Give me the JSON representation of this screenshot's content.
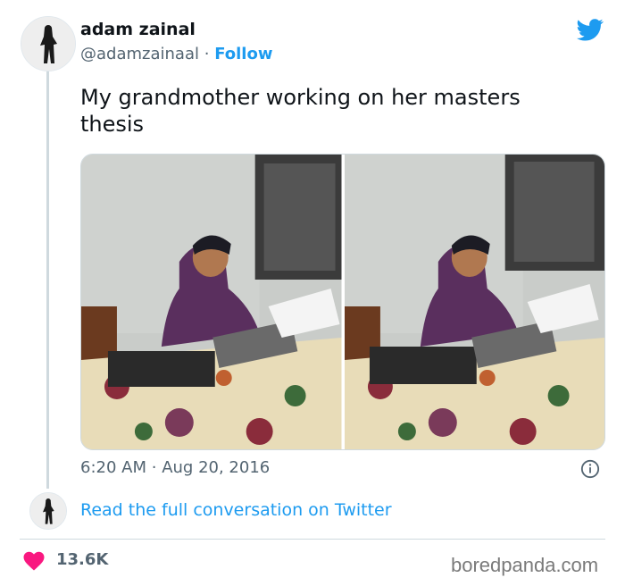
{
  "tweet": {
    "author_name": "adam zainal",
    "handle": "@adamzainaal",
    "separator": "·",
    "follow_label": "Follow",
    "text": "My grandmother working on her masters thesis",
    "time": "6:20 AM",
    "date": "Aug 20, 2016",
    "read_more": "Read the full conversation on Twitter",
    "likes": "13.6K"
  },
  "watermark": "boredpanda.com",
  "colors": {
    "twitter_blue": "#1d9bf0",
    "heart_red": "#f91880",
    "muted_text": "#536471"
  },
  "icons": [
    "twitter-bird-icon",
    "info-icon",
    "heart-icon"
  ]
}
